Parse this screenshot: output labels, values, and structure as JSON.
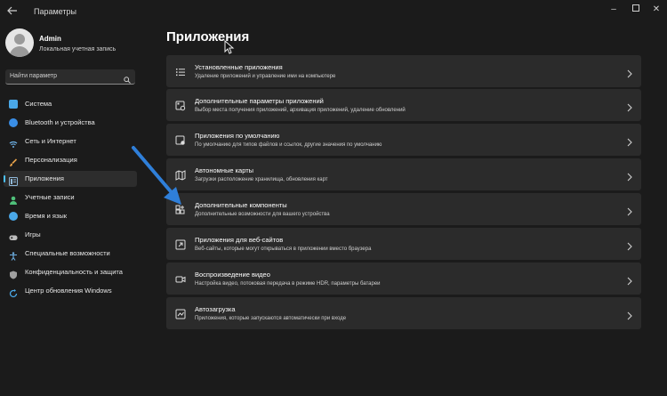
{
  "window": {
    "title": "Параметры",
    "back_icon": "back-arrow-icon",
    "min": "–",
    "max": "☐",
    "close": "✕"
  },
  "user": {
    "name": "Admin",
    "subtitle": "Локальная учетная запись"
  },
  "search": {
    "placeholder": "Найти параметр"
  },
  "nav": [
    {
      "label": "Система",
      "icon": "monitor-icon",
      "color": "#4aa8e8",
      "active": false
    },
    {
      "label": "Bluetooth и устройства",
      "icon": "bluetooth-icon",
      "color": "#3a8ee6",
      "active": false
    },
    {
      "label": "Сеть и Интернет",
      "icon": "wifi-icon",
      "color": "#6fb3e8",
      "active": false
    },
    {
      "label": "Персонализация",
      "icon": "brush-icon",
      "color": "#e8a24a",
      "active": false
    },
    {
      "label": "Приложения",
      "icon": "apps-icon",
      "color": "#8fb8d8",
      "active": true
    },
    {
      "label": "Учетные записи",
      "icon": "person-icon",
      "color": "#4fc07a",
      "active": false
    },
    {
      "label": "Время и язык",
      "icon": "globe-clock-icon",
      "color": "#4aa8e8",
      "active": false
    },
    {
      "label": "Игры",
      "icon": "gamepad-icon",
      "color": "#bdbdbd",
      "active": false
    },
    {
      "label": "Специальные возможности",
      "icon": "accessibility-icon",
      "color": "#6fb3e8",
      "active": false
    },
    {
      "label": "Конфиденциальность и защита",
      "icon": "shield-icon",
      "color": "#a0a0a0",
      "active": false
    },
    {
      "label": "Центр обновления Windows",
      "icon": "update-icon",
      "color": "#4aa8e8",
      "active": false
    }
  ],
  "main": {
    "title": "Приложения",
    "items": [
      {
        "title": "Установленные приложения",
        "desc": "Удаление приложений и управление ими на компьютере",
        "icon": "list-icon"
      },
      {
        "title": "Дополнительные параметры приложений",
        "desc": "Выбор места получения приложений, архивация приложений, удаление обновлений",
        "icon": "app-settings-icon"
      },
      {
        "title": "Приложения по умолчанию",
        "desc": "По умолчанию для типов файлов и ссылок, другие значения по умолчанию",
        "icon": "default-apps-icon"
      },
      {
        "title": "Автономные карты",
        "desc": "Загрузки расположение хранилища, обновления карт",
        "icon": "map-icon"
      },
      {
        "title": "Дополнительные компоненты",
        "desc": "Дополнительные возможности для вашего устройства",
        "icon": "components-icon"
      },
      {
        "title": "Приложения для веб-сайтов",
        "desc": "Веб-сайты, которые могут открываться в приложении вместо браузера",
        "icon": "web-app-icon"
      },
      {
        "title": "Воспроизведение видео",
        "desc": "Настройка видео, потоковая передача в режиме HDR, параметры батареи",
        "icon": "video-icon"
      },
      {
        "title": "Автозагрузка",
        "desc": "Приложения, которые запускаются автоматически при входе",
        "icon": "startup-icon"
      }
    ]
  },
  "accent": "#4cc2ff",
  "annotation": {
    "icon": "blue-arrow-icon",
    "color": "#2f7fd9"
  }
}
